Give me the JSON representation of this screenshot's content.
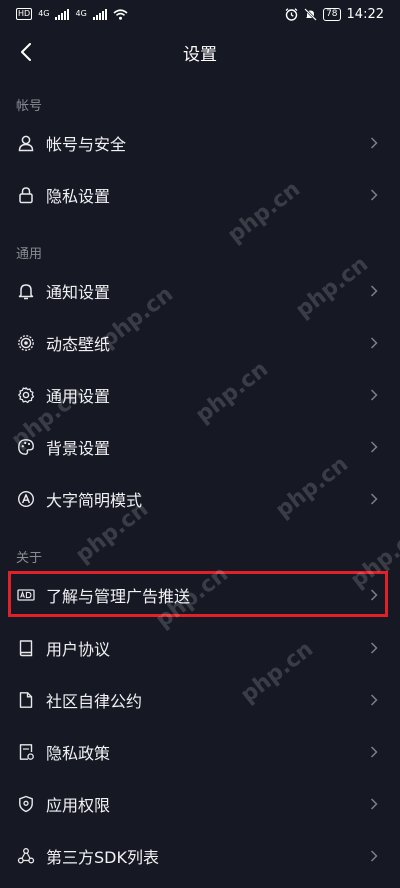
{
  "status_bar": {
    "hd_badge": "HD",
    "network_1": "4G",
    "network_2": "4G",
    "battery": "78",
    "time": "14:22"
  },
  "header": {
    "title": "设置"
  },
  "sections": [
    {
      "header": "帐号",
      "items": [
        {
          "label": "帐号与安全",
          "icon": "person-icon"
        },
        {
          "label": "隐私设置",
          "icon": "lock-icon"
        }
      ]
    },
    {
      "header": "通用",
      "items": [
        {
          "label": "通知设置",
          "icon": "bell-icon"
        },
        {
          "label": "动态壁纸",
          "icon": "wallpaper-icon"
        },
        {
          "label": "通用设置",
          "icon": "gear-icon"
        },
        {
          "label": "背景设置",
          "icon": "palette-icon"
        },
        {
          "label": "大字简明模式",
          "icon": "font-size-icon"
        }
      ]
    },
    {
      "header": "关于",
      "items": [
        {
          "label": "了解与管理广告推送",
          "icon": "ad-icon"
        },
        {
          "label": "用户协议",
          "icon": "book-icon"
        },
        {
          "label": "社区自律公约",
          "icon": "document-icon"
        },
        {
          "label": "隐私政策",
          "icon": "privacy-policy-icon"
        },
        {
          "label": "应用权限",
          "icon": "shield-icon"
        },
        {
          "label": "第三方SDK列表",
          "icon": "share-nodes-icon"
        }
      ]
    }
  ],
  "watermark": "php.cn",
  "colors": {
    "background": "#161823",
    "highlight": "#e0212a"
  }
}
